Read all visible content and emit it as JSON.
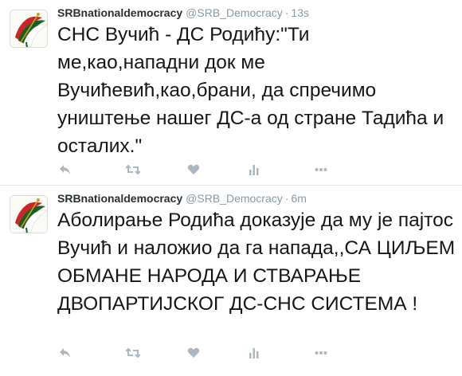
{
  "tweets": [
    {
      "display_name": "SRBnationaldemocracy",
      "handle": "@SRB_Democracy",
      "separator": "·",
      "time": "13s",
      "text": "СНС Вучић - ДС Родићу:\"Ти ме,као,нападни док ме Вучићевић,као,брани, да спречимо уништење нашег ДС-а од стране Тадића и осталих.\""
    },
    {
      "display_name": "SRBnationaldemocracy",
      "handle": "@SRB_Democracy",
      "separator": "·",
      "time": "6m",
      "text": "Аболирање Родића доказује да му је пајтос Вучић и наложио да га напада,,СА ЦИЉЕМ ОБМАНЕ НАРОДА И СТВАРАЊЕ ДВОПАРТИЈСКОГ ДС-СНС СИСТЕМА !"
    }
  ],
  "icons": {
    "reply": "reply-icon",
    "retweet": "retweet-icon",
    "like": "heart-icon",
    "analytics": "analytics-icon",
    "more": "more-icon",
    "avatar": "avatar"
  },
  "colors": {
    "icon_gray": "#aab8c2",
    "meta_gray": "#8899a6",
    "text": "#14171a"
  }
}
